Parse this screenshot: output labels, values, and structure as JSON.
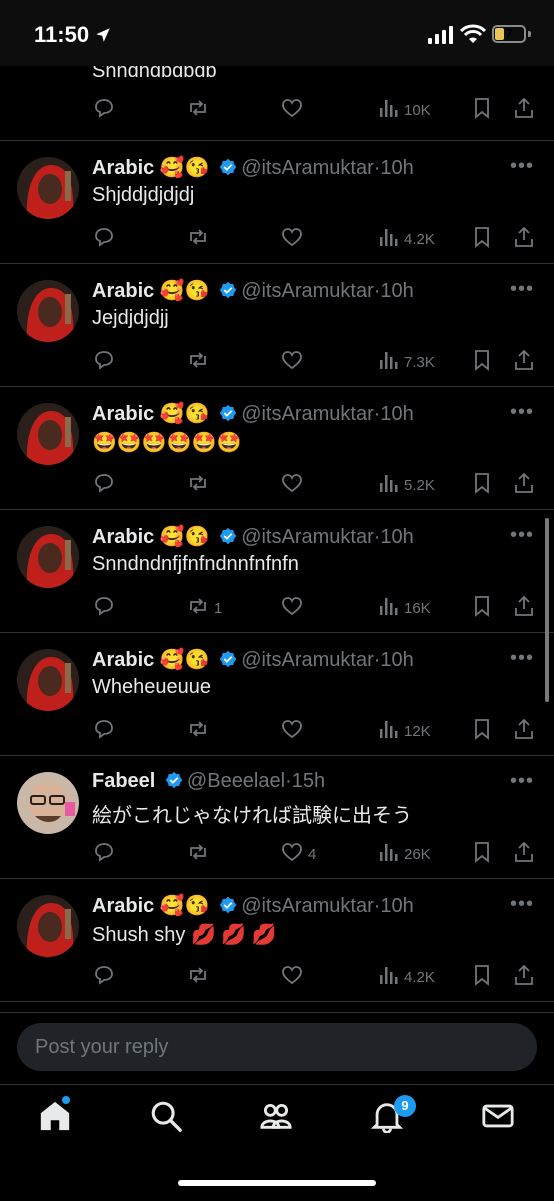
{
  "status_bar": {
    "time": "11:50",
    "battery": "7"
  },
  "tweets": [
    {
      "name": "",
      "handle": "",
      "time": "",
      "text": "Snndndbdbdb",
      "replies": "",
      "retweets": "",
      "likes": "",
      "views": "10K",
      "avatar": "arabic"
    },
    {
      "name": "Arabic",
      "emojis": "🥰😘",
      "handle": "@itsAramuktar",
      "time": "·10h",
      "text": "Shjddjdjdjdj",
      "retweets": "",
      "likes": "",
      "views": "4.2K",
      "avatar": "arabic"
    },
    {
      "name": "Arabic",
      "emojis": "🥰😘",
      "handle": "@itsAramuktar",
      "time": "·10h",
      "text": "Jejdjdjdjj",
      "retweets": "",
      "likes": "",
      "views": "7.3K",
      "avatar": "arabic"
    },
    {
      "name": "Arabic",
      "emojis": "🥰😘",
      "handle": "@itsAramuktar",
      "time": "·10h",
      "text": "🤩🤩🤩🤩🤩🤩",
      "retweets": "",
      "likes": "",
      "views": "5.2K",
      "avatar": "arabic"
    },
    {
      "name": "Arabic",
      "emojis": "🥰😘",
      "handle": "@itsAramuktar",
      "time": "·10h",
      "text": "Snndndnfjfnfndnnfnfnfn",
      "retweets": "1",
      "likes": "",
      "views": "16K",
      "avatar": "arabic"
    },
    {
      "name": "Arabic",
      "emojis": "🥰😘",
      "handle": "@itsAramuktar",
      "time": "·10h",
      "text": "Wheheueuue",
      "retweets": "",
      "likes": "",
      "views": "12K",
      "avatar": "arabic"
    },
    {
      "name": "Fabeel",
      "emojis": "",
      "handle": "@Beeelael",
      "time": "·15h",
      "text": "絵がこれじゃなければ試験に出そう",
      "retweets": "",
      "likes": "4",
      "views": "26K",
      "avatar": "fabeel"
    },
    {
      "name": "Arabic",
      "emojis": "🥰😘",
      "handle": "@itsAramuktar",
      "time": "·10h",
      "text": "Shush shy 💋 💋 💋",
      "retweets": "",
      "likes": "",
      "views": "4.2K",
      "avatar": "arabic"
    }
  ],
  "reply": {
    "placeholder": "Post your reply"
  },
  "tabbar": {
    "notifications_count": "9"
  },
  "colors": {
    "accent": "#1d9bf0",
    "muted": "#71767b",
    "text": "#e7e9ea",
    "divider": "#2f3336"
  },
  "icons": [
    "reply-icon",
    "retweet-icon",
    "like-icon",
    "views-icon",
    "bookmark-icon",
    "share-icon",
    "home-icon",
    "search-icon",
    "communities-icon",
    "bell-icon",
    "mail-icon"
  ]
}
